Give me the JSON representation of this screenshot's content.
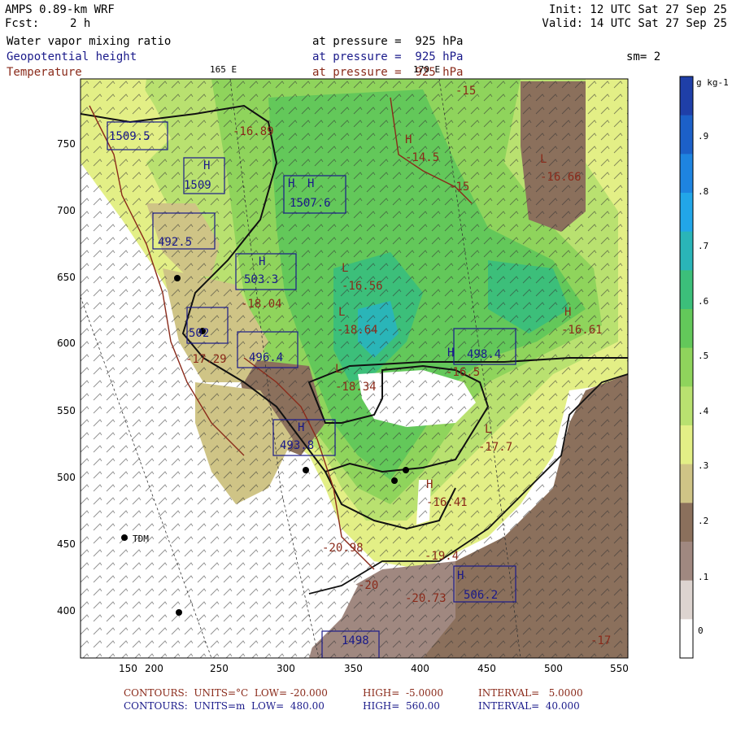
{
  "header": {
    "model": "AMPS 0.89-km WRF",
    "forecast_label": "Fcst:",
    "forecast_value": "2 h",
    "init": "Init: 12 UTC Sat 27 Sep 25",
    "valid": "Valid: 14 UTC Sat 27 Sep 25",
    "field1_name": "Water vapor mixing ratio",
    "field1_level": "at pressure =  925 hPa",
    "field2_name": "Geopotential height",
    "field2_level": "at pressure =  925 hPa",
    "field3_name": "Temperature",
    "field3_level": "at pressure =  925 hPa",
    "smoothing": "sm= 2"
  },
  "meridians": {
    "m165": "165 E",
    "m170": "170 E"
  },
  "colorbar": {
    "units": "g kg-1",
    "labels": [
      ".9",
      ".8",
      ".7",
      ".6",
      ".5",
      ".4",
      ".3",
      ".2",
      ".1",
      "0"
    ],
    "colors": [
      "#1f3fa8",
      "#1c60c8",
      "#1e84e0",
      "#22a6e8",
      "#2ab5b8",
      "#3cbf7a",
      "#63c85a",
      "#8fd45c",
      "#b9e170",
      "#e3ef86",
      "#cfc486",
      "#8b705c",
      "#a08880",
      "#ddd4d0",
      "#ffffff"
    ]
  },
  "axes": {
    "x_ticks": [
      "150",
      "200",
      "250",
      "300",
      "350",
      "400",
      "450",
      "500",
      "550"
    ],
    "y_ticks": [
      "750",
      "700",
      "650",
      "600",
      "550",
      "500",
      "450",
      "400"
    ]
  },
  "map_labels": {
    "highs": [
      "H",
      "H",
      "H",
      "H",
      "H",
      "H",
      "H",
      "H",
      "H",
      "H"
    ],
    "lows": [
      "L",
      "L",
      "L",
      "L",
      "L"
    ],
    "heights": [
      "1509.5",
      "1509",
      "1507.6",
      "492.5",
      "503.3",
      "502",
      "496.4",
      "493.8",
      "498.4",
      "506.2",
      "1498"
    ],
    "temps": [
      "-16.89",
      "-14.5",
      "-15",
      "-16.66",
      "-16.56",
      "-18.04",
      "-18.64",
      "-16.61",
      "-17.29",
      "-18.34",
      "-16.5",
      "-17.7",
      "-16.41",
      "-20.98",
      "-19.4",
      "-20.73",
      "-17",
      "-20",
      "-15"
    ],
    "station": "TDM"
  },
  "footer": {
    "line1_a": "CONTOURS:  UNITS=°C  LOW= -20.000",
    "line1_b": "HIGH=  -5.0000",
    "line1_c": "INTERVAL=   5.0000",
    "line2_a": "CONTOURS:  UNITS=m  LOW=  480.00",
    "line2_b": "HIGH=  560.00",
    "line2_c": "INTERVAL=  40.000"
  }
}
